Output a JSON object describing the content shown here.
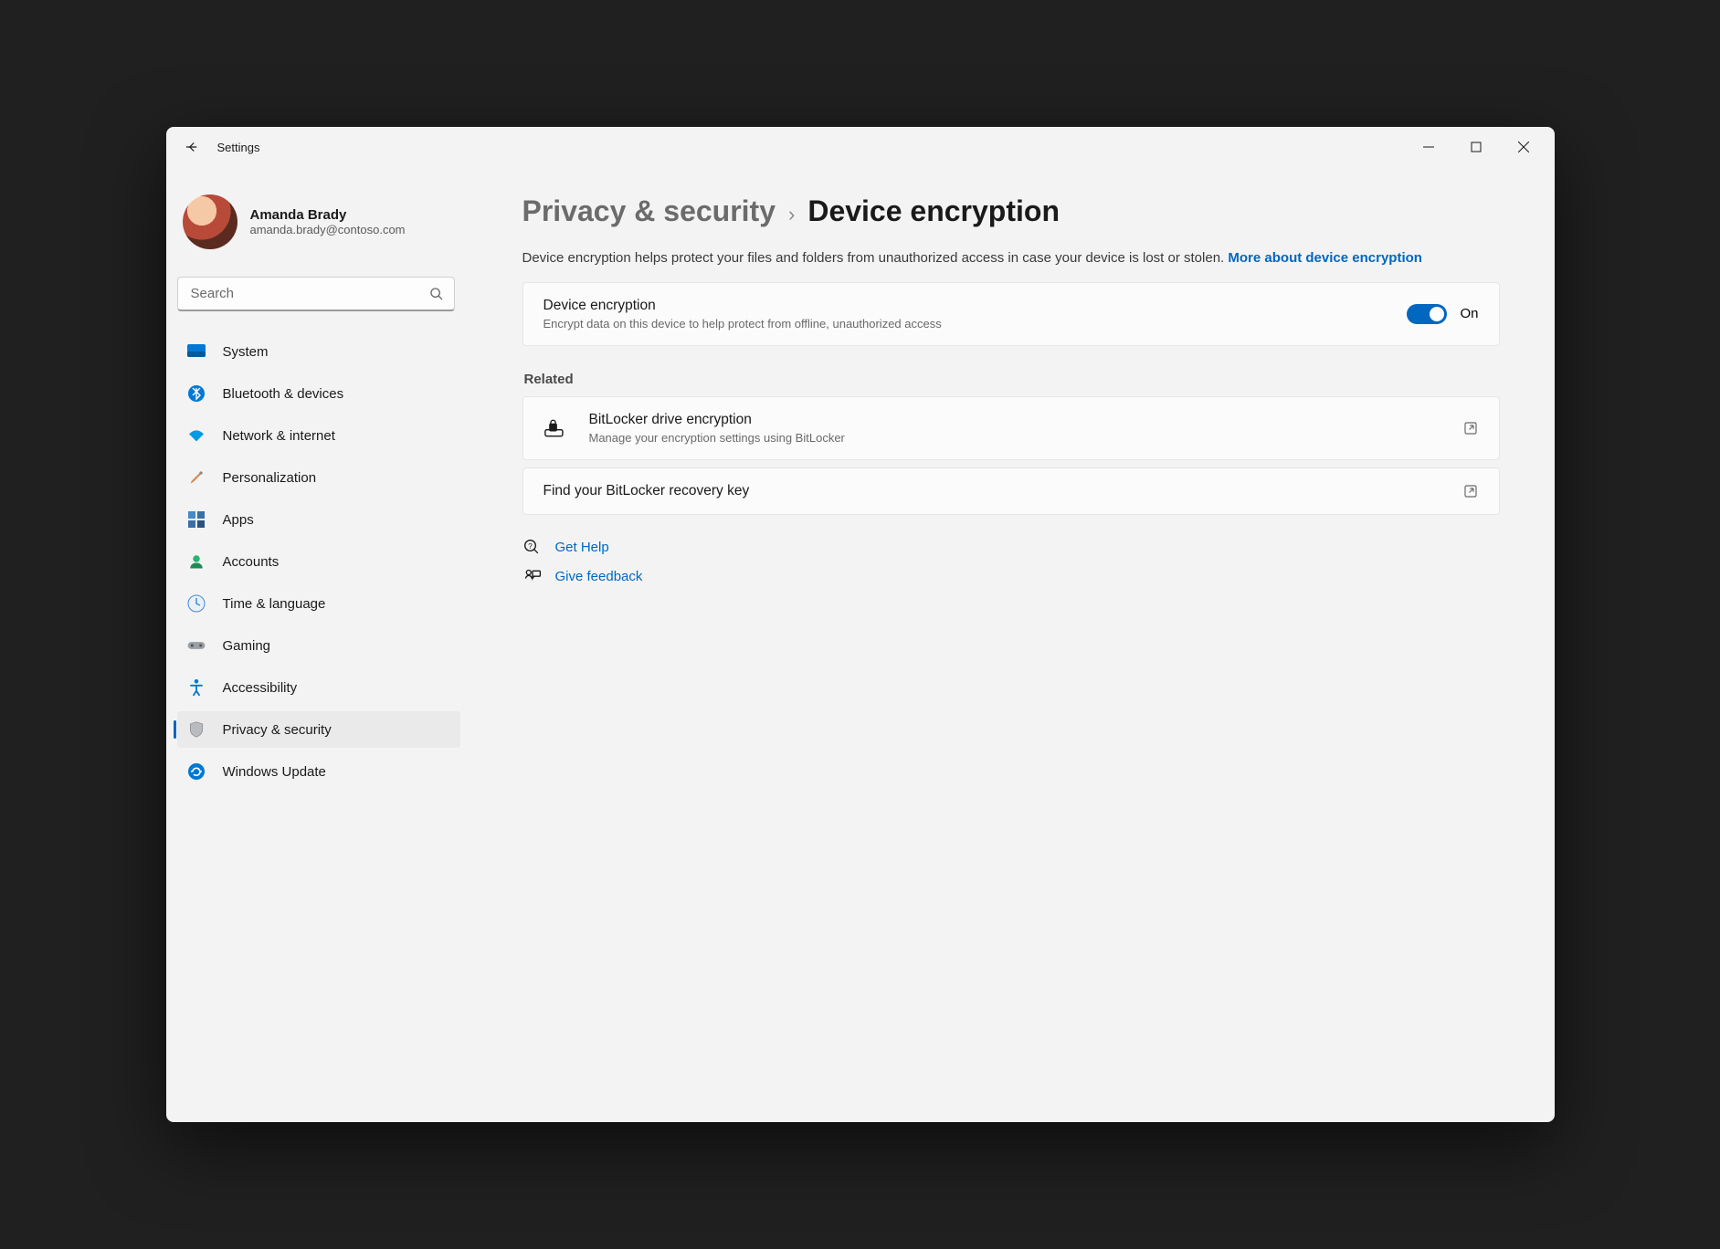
{
  "window": {
    "title": "Settings"
  },
  "profile": {
    "name": "Amanda Brady",
    "email": "amanda.brady@contoso.com"
  },
  "search": {
    "placeholder": "Search"
  },
  "sidebar": {
    "items": [
      {
        "label": "System"
      },
      {
        "label": "Bluetooth & devices"
      },
      {
        "label": "Network & internet"
      },
      {
        "label": "Personalization"
      },
      {
        "label": "Apps"
      },
      {
        "label": "Accounts"
      },
      {
        "label": "Time & language"
      },
      {
        "label": "Gaming"
      },
      {
        "label": "Accessibility"
      },
      {
        "label": "Privacy & security"
      },
      {
        "label": "Windows Update"
      }
    ]
  },
  "breadcrumb": {
    "parent": "Privacy & security",
    "current": "Device encryption"
  },
  "main": {
    "description": "Device encryption helps protect your files and folders from unauthorized access in case your device is lost or stolen. ",
    "description_link": "More about device encryption",
    "toggle_card": {
      "title": "Device encryption",
      "subtitle": "Encrypt data on this device to help protect from offline, unauthorized access",
      "state_label": "On"
    },
    "related_label": "Related",
    "related": [
      {
        "title": "BitLocker drive encryption",
        "subtitle": "Manage your encryption settings using BitLocker"
      },
      {
        "title": "Find your BitLocker recovery key"
      }
    ],
    "help": {
      "label": "Get Help"
    },
    "feedback": {
      "label": "Give feedback"
    }
  }
}
